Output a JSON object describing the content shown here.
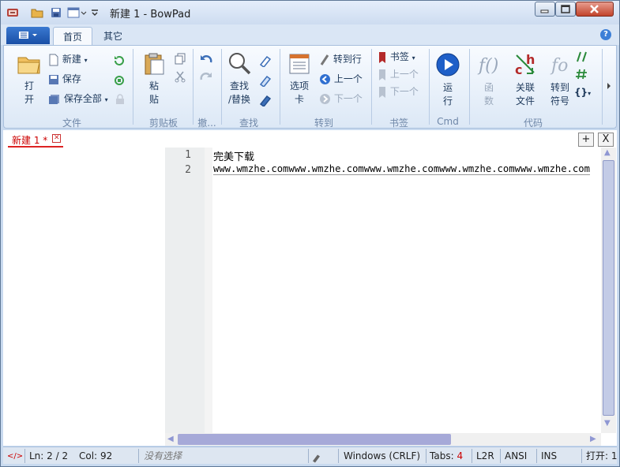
{
  "window": {
    "title": "新建 1 - BowPad"
  },
  "ribbon_tabs": [
    "首页",
    "其它"
  ],
  "app_menu_icon": "menu-icon",
  "help_icon": "?",
  "groups": {
    "file": {
      "label": "文件",
      "open": "打\n开",
      "new": "新建",
      "save": "保存",
      "save_all": "保存全部"
    },
    "clipboard": {
      "label": "剪贴板",
      "paste": "粘\n贴"
    },
    "undo": {
      "label": "撤..."
    },
    "find": {
      "label": "查找",
      "find_replace": "查找\n/替换"
    },
    "goto": {
      "label": "转到",
      "tabs": "选项\n卡",
      "goto_line": "转到行",
      "prev": "上一个",
      "next": "下一个"
    },
    "bookmark": {
      "label": "书签",
      "bookmarks": "书签",
      "prev": "上一个",
      "next": "下一个"
    },
    "cmd": {
      "label": "Cmd",
      "run": "运\n行"
    },
    "code": {
      "label": "代码",
      "function": "函\n数",
      "related": "关联\n文件",
      "goto_symbol": "转到\n符号"
    }
  },
  "document_tab": {
    "label": "新建 1 *"
  },
  "doc_buttons": {
    "add": "+",
    "close": "X"
  },
  "editor": {
    "line_numbers": [
      "1",
      "2"
    ],
    "lines": [
      "完美下载",
      "www.wmzhe.comwww.wmzhe.comwww.wmzhe.comwww.wmzhe.comwww.wmzhe.com"
    ]
  },
  "status": {
    "ln_label": "Ln:",
    "ln_value": "2 / 2",
    "col_label": "Col:",
    "col_value": "92",
    "selection": "没有选择",
    "eol": "Windows (CRLF)",
    "tabs_label": "Tabs:",
    "tabs_value": "4",
    "direction": "L2R",
    "encoding": "ANSI",
    "mode": "INS",
    "open_label": "打开: 1"
  },
  "colors": {
    "accent": "#1a4fa6",
    "tab_red": "#cc0000",
    "ribbon_bg": "#dce8f6"
  }
}
